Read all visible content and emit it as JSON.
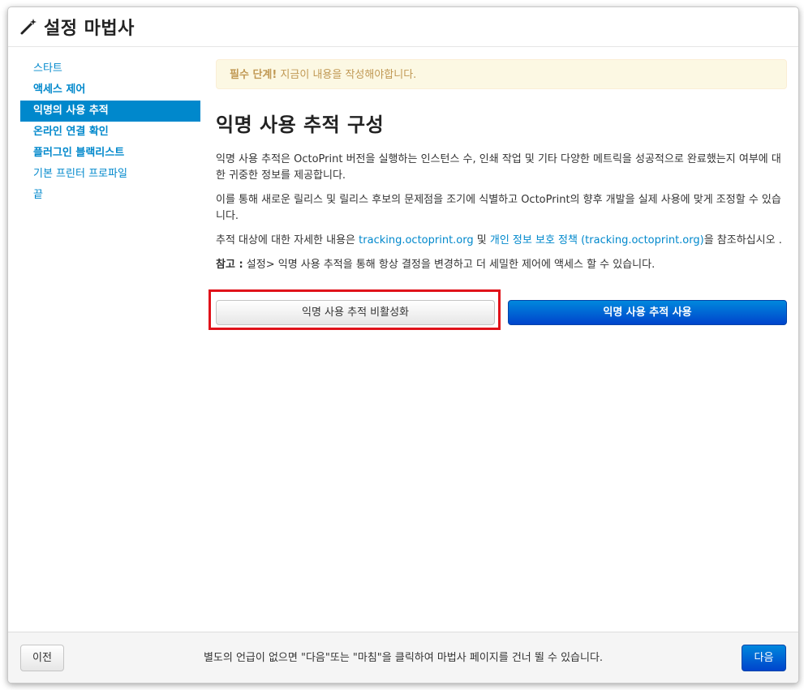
{
  "header": {
    "title": "설정 마법사",
    "icon": "magic-wand-icon"
  },
  "sidebar": {
    "items": [
      {
        "label": "스타트"
      },
      {
        "label": "액세스 제어"
      },
      {
        "label": "익명의 사용 추적",
        "active": true
      },
      {
        "label": "온라인 연결 확인"
      },
      {
        "label": "플러그인 블랙리스트"
      },
      {
        "label": "기본 프린터 프로파일"
      },
      {
        "label": "끝"
      }
    ]
  },
  "main": {
    "alert": {
      "strong": "필수 단계!",
      "text": " 지금이 내용을 작성해야합니다."
    },
    "title": "익명 사용 추적 구성",
    "para1": "익명 사용 추적은 OctoPrint 버전을 실행하는 인스턴스 수, 인쇄 작업 및 기타 다양한 메트릭을 성공적으로 완료했는지 여부에 대한 귀중한 정보를 제공합니다.",
    "para2": "이를 통해 새로운 릴리스 및 릴리스 후보의 문제점을 조기에 식별하고 OctoPrint의 향후 개발을 실제 사용에 맞게 조정할 수 있습니다.",
    "para3": {
      "before": "추적 대상에 대한 자세한 내용은 ",
      "link1": "tracking.octoprint.org",
      "middle": " 및 ",
      "link2": "개인 정보 보호 정책 (tracking.octoprint.org)",
      "after": "을 참조하십시오 ."
    },
    "note": {
      "label": "참고 :",
      "text": " 설정> 익명 사용 추적을 통해 항상 결정을 변경하고 더 세밀한 제어에 액세스 할 수 있습니다."
    },
    "disable_button": "익명 사용 추적 비활성화",
    "enable_button": "익명 사용 추적 사용"
  },
  "footer": {
    "prev_button": "이전",
    "note": "별도의 언급이 없으면 \"다음\"또는 \"마침\"을 클릭하여 마법사 페이지를 건너 뛸 수 있습니다.",
    "next_button": "다음"
  },
  "colors": {
    "link": "#0088cc",
    "primary": "#0055cc",
    "highlight": "#e0121a",
    "alert_bg": "#fcf8e3"
  }
}
